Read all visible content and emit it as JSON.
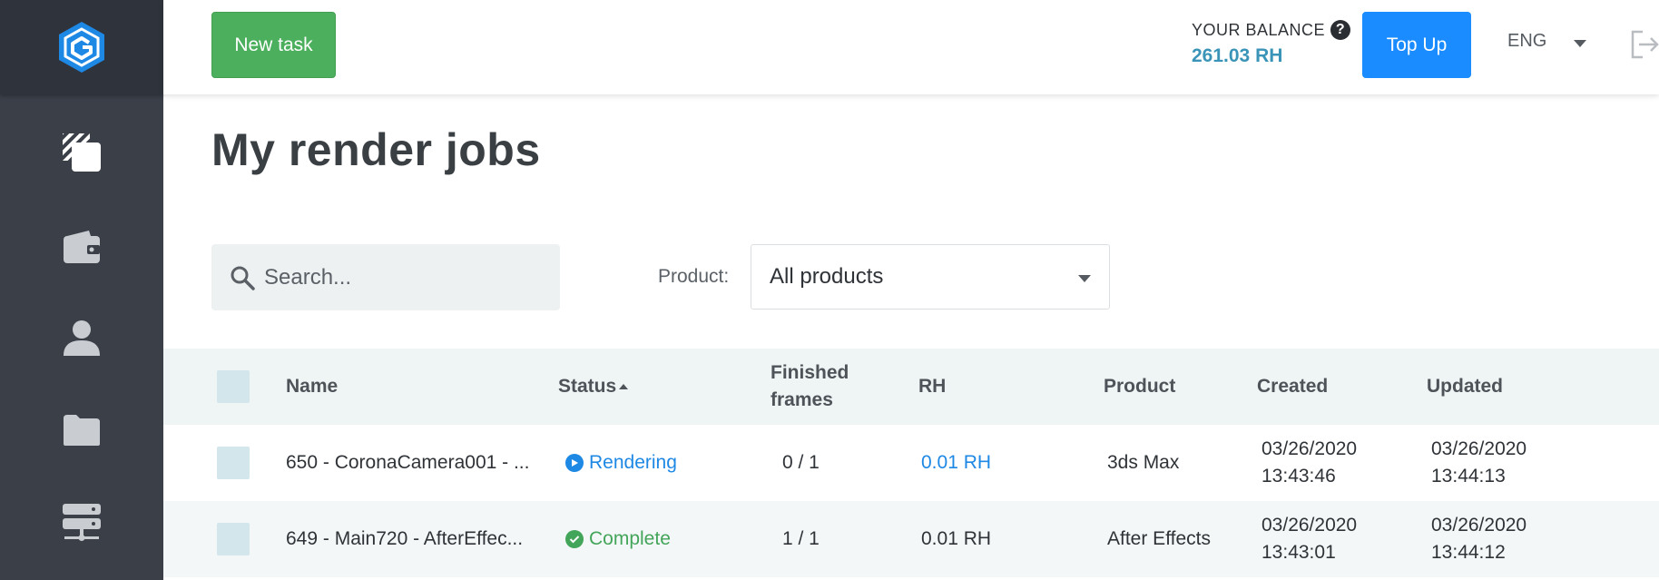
{
  "header": {
    "new_task_label": "New task",
    "balance_label": "YOUR BALANCE",
    "balance_value": "261.03 RH",
    "topup_label": "Top Up",
    "language": "ENG",
    "help_icon": "?"
  },
  "sidebar": {
    "items": [
      {
        "name": "render-jobs",
        "icon": "render-jobs-icon"
      },
      {
        "name": "wallet",
        "icon": "wallet-icon"
      },
      {
        "name": "profile",
        "icon": "user-icon"
      },
      {
        "name": "files",
        "icon": "folder-icon"
      },
      {
        "name": "servers",
        "icon": "server-icon"
      }
    ]
  },
  "main": {
    "title": "My render jobs",
    "search_placeholder": "Search...",
    "product_label": "Product:",
    "product_value": "All products"
  },
  "table": {
    "columns": {
      "name": "Name",
      "status": "Status",
      "frames_line1": "Finished",
      "frames_line2": "frames",
      "rh": "RH",
      "product": "Product",
      "created": "Created",
      "updated": "Updated"
    },
    "rows": [
      {
        "name": "650 - CoronaCamera001 - ...",
        "status": "Rendering",
        "frames": "0 / 1",
        "rh": "0.01 RH",
        "product": "3ds Max",
        "created_date": "03/26/2020",
        "created_time": "13:43:46",
        "updated_date": "03/26/2020",
        "updated_time": "13:44:13"
      },
      {
        "name": "649 - Main720 - AfterEffec...",
        "status": "Complete",
        "frames": "1 / 1",
        "rh": "0.01 RH",
        "product": "After Effects",
        "created_date": "03/26/2020",
        "created_time": "13:43:01",
        "updated_date": "03/26/2020",
        "updated_time": "13:44:12"
      }
    ]
  },
  "colors": {
    "sidebar": "#3a3f48",
    "new_task": "#4caf5d",
    "topup": "#1a8cff",
    "balance": "#3a94b8",
    "rendering": "#1e88e5",
    "complete": "#43a55a"
  }
}
